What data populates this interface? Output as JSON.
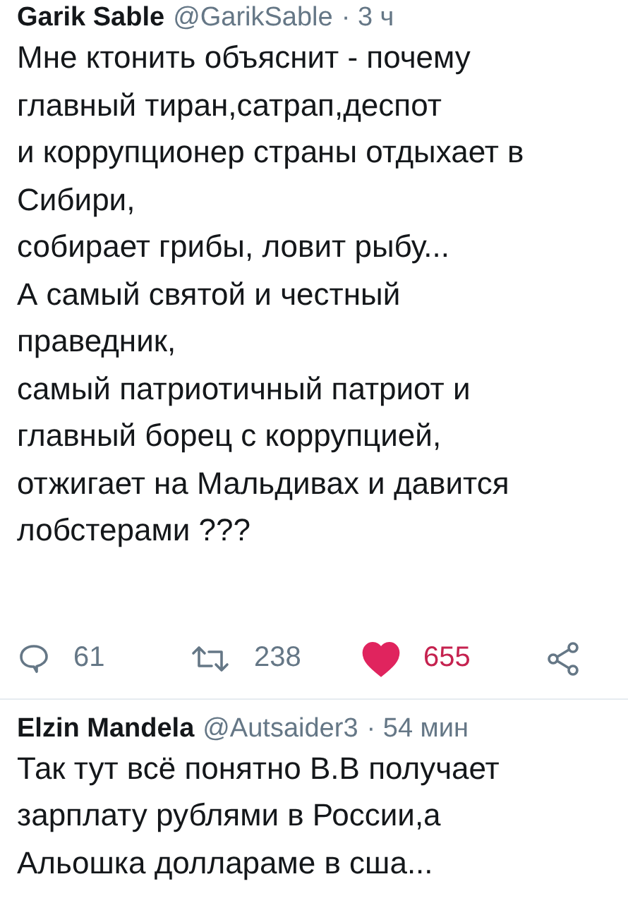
{
  "tweets": [
    {
      "name": "Garik Sable",
      "handle": "@GarikSable",
      "time": "· 3 ч",
      "text": "Мне ктонить объяснит - почему\nглавный тиран,сатрап,деспот\nи коррупционер страны отдыхает в\nСибири,\nсобирает грибы, ловит рыбу...\nА самый святой и честный\nправедник,\nсамый патриотичный патриот и\nглавный борец с коррупцией,\nотжигает на Мальдивах и давится\nлобстерами ???",
      "actions": {
        "replies": "61",
        "retweets": "238",
        "likes": "655",
        "liked": true
      }
    },
    {
      "name": "Elzin Mandela",
      "handle": "@Autsaider3",
      "time": "· 54 мин",
      "text": "Так тут всё понятно В.В получает\nзарплату рублями в России,а\nАльошка доллараме в сша..."
    }
  ]
}
